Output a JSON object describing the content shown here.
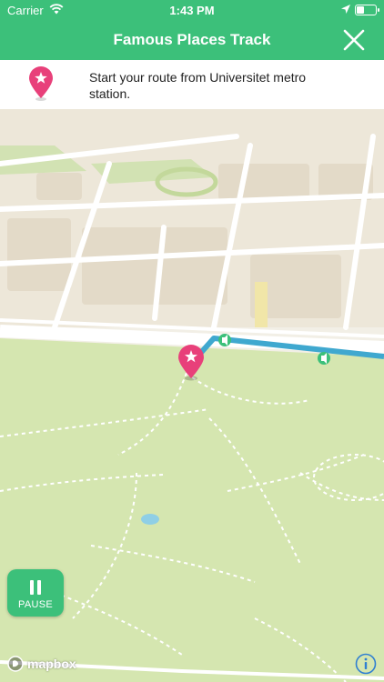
{
  "status_bar": {
    "carrier": "Carrier",
    "time": "1:43 PM"
  },
  "nav": {
    "title": "Famous Places Track"
  },
  "banner": {
    "text": "Start your route from Universitet metro station."
  },
  "controls": {
    "pause_label": "PAUSE",
    "mapbox_label": "mapbox"
  },
  "colors": {
    "accent": "#3cc07a",
    "pin": "#e8407a",
    "route": "#3fa8cf"
  },
  "icons": {
    "close": "close-icon",
    "pin": "star-pin-icon",
    "pause": "pause-icon",
    "info": "info-icon"
  }
}
